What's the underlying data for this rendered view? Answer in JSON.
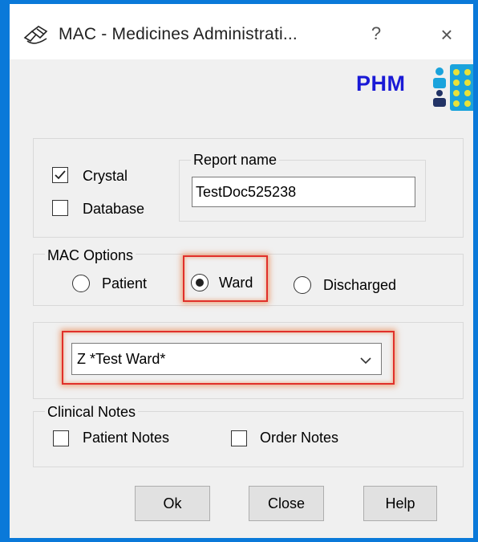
{
  "window": {
    "title": "MAC - Medicines Administrati...",
    "help_glyph": "?",
    "close_glyph": "×"
  },
  "brand": {
    "text": "PHM",
    "color": "#1a1ad6"
  },
  "report_type": {
    "crystal": {
      "label": "Crystal",
      "checked": true
    },
    "database": {
      "label": "Database",
      "checked": false
    }
  },
  "report_name": {
    "legend": "Report name",
    "value": "TestDoc525238"
  },
  "mac_options": {
    "legend": "MAC Options",
    "options": [
      {
        "label": "Patient",
        "selected": false
      },
      {
        "label": "Ward",
        "selected": true
      },
      {
        "label": "Discharged",
        "selected": false
      }
    ]
  },
  "ward_select": {
    "value": "Z *Test Ward*"
  },
  "clinical_notes": {
    "legend": "Clinical Notes",
    "patient_notes": {
      "label": "Patient Notes",
      "checked": false
    },
    "order_notes": {
      "label": "Order Notes",
      "checked": false
    }
  },
  "buttons": {
    "ok": "Ok",
    "close": "Close",
    "help": "Help"
  },
  "colors": {
    "highlight": "#e0302a",
    "window_border": "#0a79d9"
  }
}
